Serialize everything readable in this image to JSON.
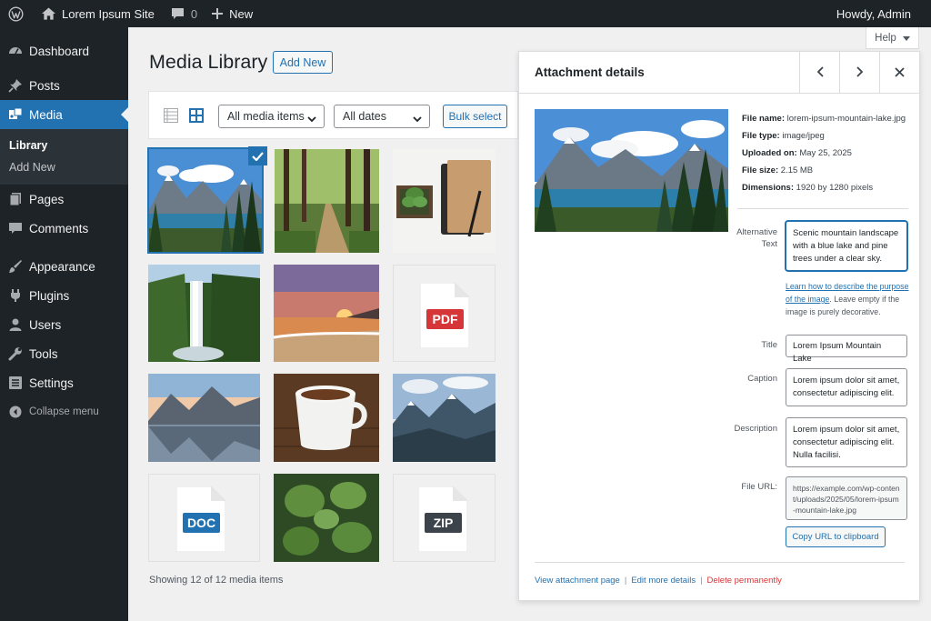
{
  "admin_bar": {
    "site_name": "Lorem Ipsum Site",
    "comments_count": "0",
    "new_label": "New",
    "greeting": "Howdy, Admin"
  },
  "sidebar": {
    "items": [
      {
        "label": "Dashboard",
        "icon": "dashboard-icon"
      },
      {
        "label": "Posts",
        "icon": "pin-icon"
      },
      {
        "label": "Media",
        "icon": "media-icon"
      },
      {
        "label": "Pages",
        "icon": "pages-icon"
      },
      {
        "label": "Comments",
        "icon": "comment-icon"
      },
      {
        "label": "Appearance",
        "icon": "brush-icon"
      },
      {
        "label": "Plugins",
        "icon": "plug-icon"
      },
      {
        "label": "Users",
        "icon": "user-icon"
      },
      {
        "label": "Tools",
        "icon": "wrench-icon"
      },
      {
        "label": "Settings",
        "icon": "settings-icon"
      }
    ],
    "submenu": [
      "Library",
      "Add New"
    ],
    "collapse_label": "Collapse menu"
  },
  "help_label": "Help",
  "page": {
    "title": "Media Library",
    "add_new_label": "Add New"
  },
  "toolbar": {
    "type_filter": "All media items",
    "date_filter": "All dates",
    "bulk_select_label": "Bulk select"
  },
  "grid": {
    "pdf_label": "PDF",
    "doc_label": "DOC",
    "zip_label": "ZIP",
    "showing_text": "Showing 12 of 12 media items"
  },
  "attachment": {
    "panel_title": "Attachment details",
    "file_name_label": "File name:",
    "file_name": "lorem-ipsum-mountain-lake.jpg",
    "file_type_label": "File type:",
    "file_type": "image/jpeg",
    "uploaded_label": "Uploaded on:",
    "uploaded": "May 25, 2025",
    "file_size_label": "File size:",
    "file_size": "2.15 MB",
    "dimensions_label": "Dimensions:",
    "dimensions": "1920 by 1280 pixels",
    "alt_label": "Alternative Text",
    "alt_text": "Scenic mountain landscape with a blue lake and pine trees under a clear sky.",
    "alt_help_link": "Learn how to describe the purpose of the image",
    "alt_help_rest": ". Leave empty if the image is purely decorative.",
    "title_label": "Title",
    "title_value": "Lorem Ipsum Mountain Lake",
    "caption_label": "Caption",
    "caption_value": "Lorem ipsum dolor sit amet, consectetur adipiscing elit.",
    "description_label": "Description",
    "description_value": "Lorem ipsum dolor sit amet, consectetur adipiscing elit. Nulla facilisi.",
    "file_url_label": "File URL:",
    "file_url": "https://example.com/wp-content/uploads/2025/05/lorem-ipsum-mountain-lake.jpg",
    "copy_url_label": "Copy URL to clipboard",
    "view_page_label": "View attachment page",
    "edit_details_label": "Edit more details",
    "delete_label": "Delete permanently"
  },
  "colors": {
    "admin_dark": "#1d2327",
    "accent": "#2271b1",
    "danger": "#d63638",
    "pdf_red": "#d63638",
    "doc_blue": "#2271b1",
    "zip_gray": "#3c434a"
  }
}
